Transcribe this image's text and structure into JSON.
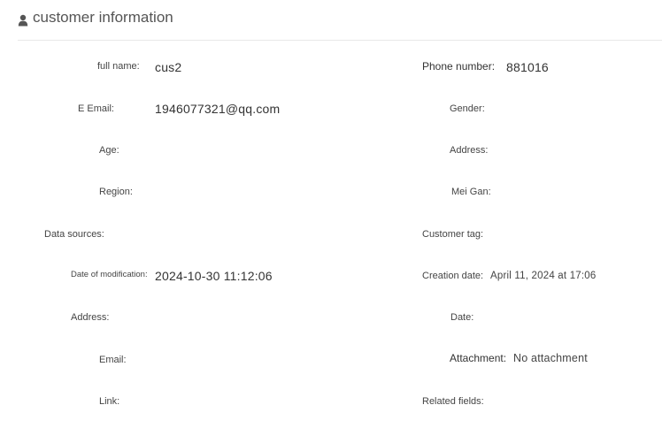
{
  "header": {
    "title": "customer information",
    "icon": "user-icon"
  },
  "fields": {
    "full_name_label": "full name:",
    "full_name_value": "cus2",
    "phone_label": "Phone number:",
    "phone_value": "881016",
    "email_label": "E Email:",
    "email_value": "1946077321@qq.com",
    "gender_label": "Gender:",
    "age_label": "Age:",
    "address_label": "Address:",
    "region_label": "Region:",
    "mei_gan_label": "Mei Gan:",
    "data_sources_label": "Data sources:",
    "customer_tag_label": "Customer tag:",
    "date_modification_label": "Date of modification:",
    "date_modification_value": "2024-10-30 11:12:06",
    "creation_date_label": "Creation date:",
    "creation_date_value": "April 11, 2024 at 17:06",
    "address2_label": "Address:",
    "date_label": "Date:",
    "email2_label": "Email:",
    "attachment_label": "Attachment:",
    "attachment_value": "No attachment",
    "link_label": "Link:",
    "related_fields_label": "Related fields:"
  }
}
